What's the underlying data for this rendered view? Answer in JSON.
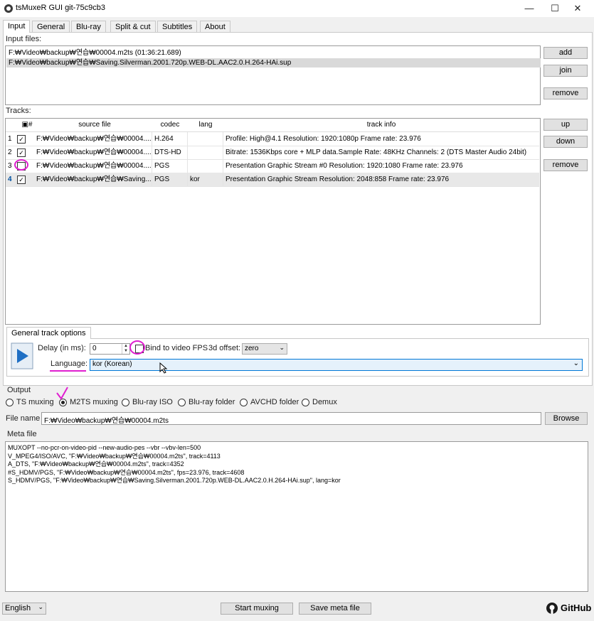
{
  "window": {
    "title": "tsMuxeR GUI git-75c9cb3",
    "minimize": "—",
    "maximize": "☐",
    "close": "✕"
  },
  "tabs": [
    "Input",
    "General",
    "Blu-ray",
    "Split & cut",
    "Subtitles",
    "About"
  ],
  "input_files": {
    "label": "Input files:",
    "items": [
      "F:₩Video₩backup₩연습₩00004.m2ts (01:36:21.689)",
      "F:₩Video₩backup₩연습₩Saving.Silverman.2001.720p.WEB-DL.AAC2.0.H.264-HAi.sup"
    ],
    "buttons": {
      "add": "add",
      "join": "join",
      "remove": "remove"
    }
  },
  "tracks": {
    "label": "Tracks:",
    "headers": {
      "check": "▣#",
      "source": "source file",
      "codec": "codec",
      "lang": "lang",
      "info": "track info"
    },
    "rows": [
      {
        "num": "1",
        "checked": "✓",
        "source": "F:₩Video₩backup₩연습₩00004....",
        "codec": "H.264",
        "lang": "",
        "info": "Profile: High@4.1  Resolution: 1920:1080p  Frame rate: 23.976"
      },
      {
        "num": "2",
        "checked": "✓",
        "source": "F:₩Video₩backup₩연습₩00004....",
        "codec": "DTS-HD",
        "lang": "",
        "info": "Bitrate: 1536Kbps  core + MLP data.Sample Rate: 48KHz  Channels: 2 (DTS Master Audio 24bit)"
      },
      {
        "num": "3",
        "checked": "",
        "source": "F:₩Video₩backup₩연습₩00004....",
        "codec": "PGS",
        "lang": "",
        "info": "Presentation Graphic Stream #0 Resolution: 1920:1080 Frame rate: 23.976"
      },
      {
        "num": "4",
        "checked": "✓",
        "source": "F:₩Video₩backup₩연습₩Saving....",
        "codec": "PGS",
        "lang": "kor",
        "info": "Presentation Graphic Stream Resolution: 2048:858 Frame rate: 23.976"
      }
    ],
    "buttons": {
      "up": "up",
      "down": "down",
      "remove": "remove"
    }
  },
  "track_options": {
    "tab": "General track options",
    "delay_label": "Delay (in ms):",
    "delay_value": "0",
    "bind_fps": "Bind to video FPS",
    "offset_label": "3d offset:",
    "offset_value": "zero",
    "language_label": "Language:",
    "language_value": "kor (Korean)"
  },
  "output": {
    "label": "Output",
    "options": [
      "TS muxing",
      "M2TS muxing",
      "Blu-ray ISO",
      "Blu-ray folder",
      "AVCHD folder",
      "Demux"
    ],
    "selected": "M2TS muxing",
    "file_label": "File name",
    "file_value": "F:₩Video₩backup₩연습₩00004.m2ts",
    "browse": "Browse"
  },
  "meta": {
    "label": "Meta file",
    "lines": [
      "MUXOPT --no-pcr-on-video-pid --new-audio-pes --vbr --vbv-len=500",
      "V_MPEG4/ISO/AVC, \"F:₩Video₩backup₩연습₩00004.m2ts\", track=4113",
      "A_DTS, \"F:₩Video₩backup₩연습₩00004.m2ts\", track=4352",
      "#S_HDMV/PGS, \"F:₩Video₩backup₩연습₩00004.m2ts\", fps=23.976, track=4608",
      "S_HDMV/PGS, \"F:₩Video₩backup₩연습₩Saving.Silverman.2001.720p.WEB-DL.AAC2.0.H.264-HAi.sup\", lang=kor"
    ]
  },
  "footer": {
    "language": "English",
    "start": "Start muxing",
    "save_meta": "Save meta file",
    "github": "GitHub"
  },
  "colors": {
    "annotation": "#e01fd0",
    "accent": "#0078d7"
  }
}
